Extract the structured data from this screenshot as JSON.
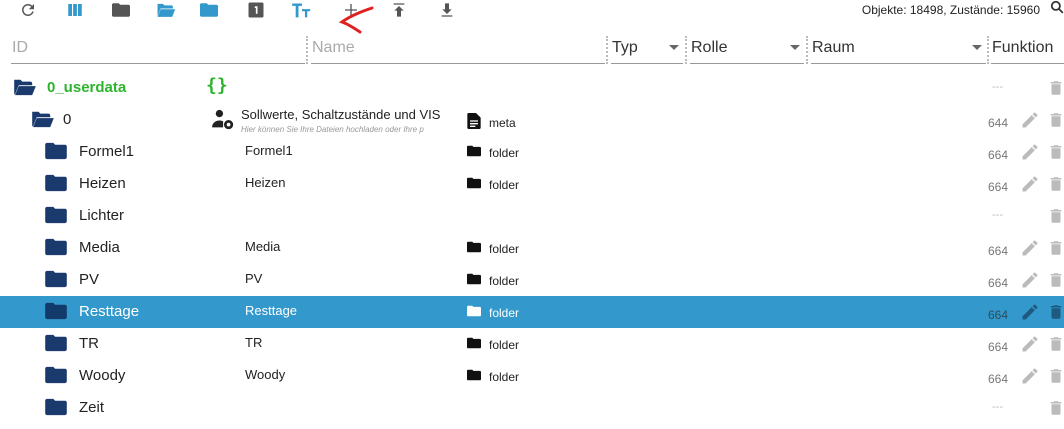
{
  "toolbar": {
    "icons": [
      "refresh-icon",
      "columns-icon",
      "folder-closed-icon",
      "folder-open-icon",
      "folder-icon",
      "number-one-icon",
      "text-size-icon",
      "plus-icon",
      "upload-icon",
      "download-icon"
    ],
    "stats": "Objekte: 18498, Zustände: 15960"
  },
  "header": {
    "id": "ID",
    "name": "Name",
    "typ": "Typ",
    "rolle": "Rolle",
    "raum": "Raum",
    "funktion": "Funktion"
  },
  "rows": [
    {
      "label": "0_userdata",
      "level": 0,
      "open": true,
      "root": true,
      "acl": "---"
    },
    {
      "label": "0",
      "level": 1,
      "open": true,
      "custom_name": "Sollwerte, Schaltzustände und VIS",
      "custom_desc": "Hier können Sie Ihre Dateien hochladen oder Ihre p",
      "type": "meta",
      "acl": "644"
    },
    {
      "label": "Formel1",
      "level": 2,
      "name": "Formel1",
      "type": "folder",
      "acl": "664"
    },
    {
      "label": "Heizen",
      "level": 2,
      "name": "Heizen",
      "type": "folder",
      "acl": "664"
    },
    {
      "label": "Lichter",
      "level": 2,
      "acl": "---"
    },
    {
      "label": "Media",
      "level": 2,
      "name": "Media",
      "type": "folder",
      "acl": "664"
    },
    {
      "label": "PV",
      "level": 2,
      "name": "PV",
      "type": "folder",
      "acl": "664"
    },
    {
      "label": "Resttage",
      "level": 2,
      "name": "Resttage",
      "type": "folder",
      "acl": "664",
      "selected": true
    },
    {
      "label": "TR",
      "level": 2,
      "name": "TR",
      "type": "folder",
      "acl": "664"
    },
    {
      "label": "Woody",
      "level": 2,
      "name": "Woody",
      "type": "folder",
      "acl": "664"
    },
    {
      "label": "Zeit",
      "level": 2,
      "acl": "---"
    }
  ],
  "colors": {
    "accent": "#3399cc",
    "folder": "#1a3a6e",
    "root_text": "#2db42d",
    "selected_bg": "#3399cc"
  }
}
